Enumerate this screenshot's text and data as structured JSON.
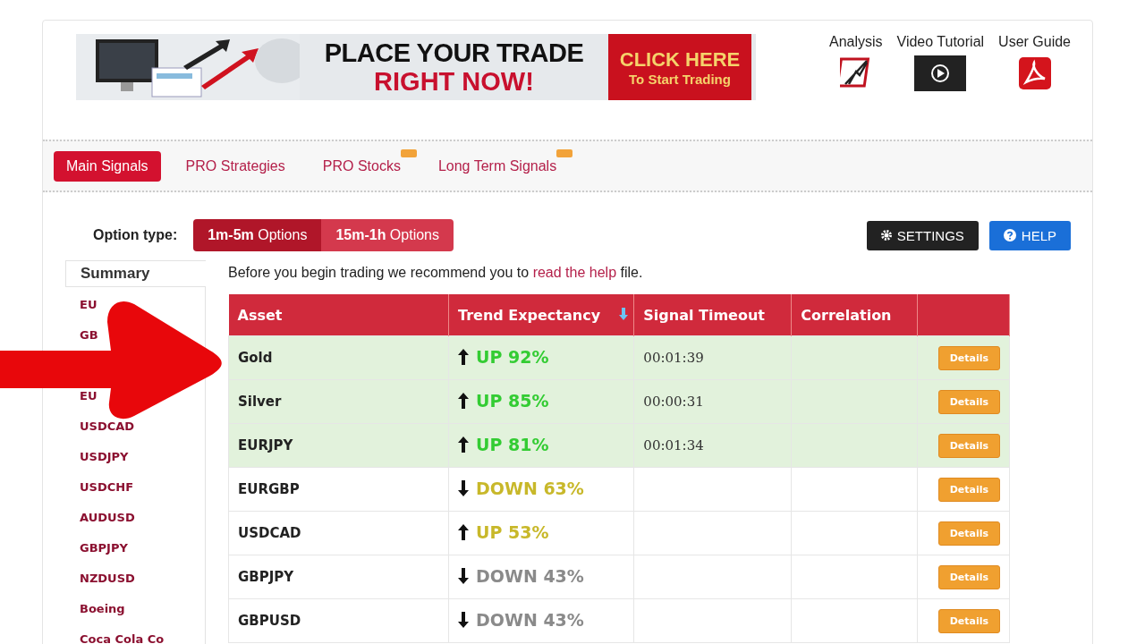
{
  "banner": {
    "headline": [
      "PLACE YOUR TRADE",
      "RIGHT NOW!"
    ],
    "cta": {
      "title": "CLICK HERE",
      "subtitle": "To Start Trading"
    }
  },
  "header_links": [
    {
      "label": "Analysis",
      "kind": "analysis"
    },
    {
      "label": "Video Tutorial",
      "kind": "video"
    },
    {
      "label": "User Guide",
      "kind": "pdf"
    }
  ],
  "tabs": [
    {
      "label": "Main Signals",
      "selected": true,
      "new": false
    },
    {
      "label": "PRO Strategies",
      "selected": false,
      "new": false
    },
    {
      "label": "PRO Stocks",
      "selected": false,
      "new": true
    },
    {
      "label": "Long Term Signals",
      "selected": false,
      "new": true
    }
  ],
  "option_type": {
    "label": "Option type:",
    "options": [
      {
        "label_bold": "1m-5m",
        "label": "Options",
        "selected": true
      },
      {
        "label_bold": "15m-1h",
        "label": "Options",
        "selected": false
      }
    ]
  },
  "buttons": [
    {
      "label": "SETTINGS",
      "kind": "settings"
    },
    {
      "label": "HELP",
      "kind": "help"
    }
  ],
  "sidebar": {
    "title": "Summary",
    "items": [
      "EU",
      "GB",
      "EU",
      "USDCAD",
      "USDJPY",
      "USDCHF",
      "AUDUSD",
      "GBPJPY",
      "NZDUSD",
      "Boeing",
      "Coca Cola Co"
    ]
  },
  "intro": {
    "before": "Before you begin trading we recommend you to",
    "link": "read the help",
    "after": "file."
  },
  "table": {
    "columns": [
      "Asset",
      "Trend Expectancy",
      "Signal Timeout",
      "Correlation"
    ],
    "rows": [
      {
        "asset": "Gold",
        "rising": true,
        "trend": "UP 92%",
        "color": "#33cc33",
        "timeout": "00:01:39",
        "highlighted": true,
        "action": "Details"
      },
      {
        "asset": "Silver",
        "rising": true,
        "trend": "UP 85%",
        "color": "#33cc33",
        "timeout": "00:00:31",
        "highlighted": true,
        "action": "Details"
      },
      {
        "asset": "EURJPY",
        "rising": true,
        "trend": "UP 81%",
        "color": "#33cc33",
        "timeout": "00:01:34",
        "highlighted": true,
        "action": "Details"
      },
      {
        "asset": "EURGBP",
        "rising": false,
        "trend": "DOWN 63%",
        "color": "#c8b82a",
        "highlighted": false,
        "action": "Details"
      },
      {
        "asset": "USDCAD",
        "rising": true,
        "trend": "UP 53%",
        "color": "#c8b82a",
        "highlighted": false,
        "action": "Details"
      },
      {
        "asset": "GBPJPY",
        "rising": false,
        "trend": "DOWN 43%",
        "color": "#8a8a8a",
        "highlighted": false,
        "action": "Details"
      },
      {
        "asset": "GBPUSD",
        "rising": false,
        "trend": "DOWN 43%",
        "color": "#8a8a8a",
        "highlighted": false,
        "action": "Details"
      }
    ]
  }
}
